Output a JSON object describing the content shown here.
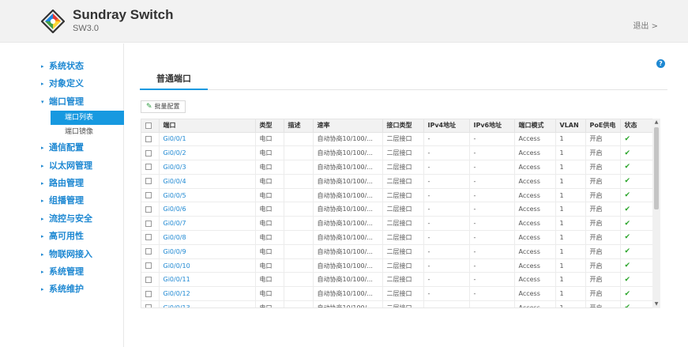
{
  "header": {
    "brand_title": "Sundray Switch",
    "brand_sub": "SW3.0",
    "logout": "退出 >"
  },
  "sidebar": {
    "items": [
      {
        "label": "系统状态",
        "arrow": "▸"
      },
      {
        "label": "对象定义",
        "arrow": "▸"
      },
      {
        "label": "端口管理",
        "arrow": "▾",
        "children": [
          {
            "label": "端口列表",
            "active": true
          },
          {
            "label": "端口镜像",
            "active": false
          }
        ]
      },
      {
        "label": "通信配置",
        "arrow": "▸"
      },
      {
        "label": "以太网管理",
        "arrow": "▸"
      },
      {
        "label": "路由管理",
        "arrow": "▸"
      },
      {
        "label": "组播管理",
        "arrow": "▸"
      },
      {
        "label": "流控与安全",
        "arrow": "▸"
      },
      {
        "label": "高可用性",
        "arrow": "▸"
      },
      {
        "label": "物联网接入",
        "arrow": "▸"
      },
      {
        "label": "系统管理",
        "arrow": "▸"
      },
      {
        "label": "系统维护",
        "arrow": "▸"
      }
    ]
  },
  "main": {
    "help": "?",
    "tab": "普通端口",
    "batch_button": "批量配置",
    "batch_icon": "✎",
    "table": {
      "columns": [
        "端口",
        "类型",
        "描述",
        "速率",
        "接口类型",
        "IPv4地址",
        "IPv6地址",
        "端口模式",
        "VLAN",
        "PoE供电",
        "状态"
      ],
      "rows": [
        {
          "port": "Gi0/0/1",
          "type": "电口",
          "desc": "",
          "rate": "自动协商10/100/...",
          "iface": "二层接口",
          "ipv4": "-",
          "ipv6": "-",
          "mode": "Access",
          "vlan": "1",
          "poe": "开启",
          "status": "✔"
        },
        {
          "port": "Gi0/0/2",
          "type": "电口",
          "desc": "",
          "rate": "自动协商10/100/...",
          "iface": "二层接口",
          "ipv4": "-",
          "ipv6": "-",
          "mode": "Access",
          "vlan": "1",
          "poe": "开启",
          "status": "✔"
        },
        {
          "port": "Gi0/0/3",
          "type": "电口",
          "desc": "",
          "rate": "自动协商10/100/...",
          "iface": "二层接口",
          "ipv4": "-",
          "ipv6": "-",
          "mode": "Access",
          "vlan": "1",
          "poe": "开启",
          "status": "✔"
        },
        {
          "port": "Gi0/0/4",
          "type": "电口",
          "desc": "",
          "rate": "自动协商10/100/...",
          "iface": "二层接口",
          "ipv4": "-",
          "ipv6": "-",
          "mode": "Access",
          "vlan": "1",
          "poe": "开启",
          "status": "✔"
        },
        {
          "port": "Gi0/0/5",
          "type": "电口",
          "desc": "",
          "rate": "自动协商10/100/...",
          "iface": "二层接口",
          "ipv4": "-",
          "ipv6": "-",
          "mode": "Access",
          "vlan": "1",
          "poe": "开启",
          "status": "✔"
        },
        {
          "port": "Gi0/0/6",
          "type": "电口",
          "desc": "",
          "rate": "自动协商10/100/...",
          "iface": "二层接口",
          "ipv4": "-",
          "ipv6": "-",
          "mode": "Access",
          "vlan": "1",
          "poe": "开启",
          "status": "✔"
        },
        {
          "port": "Gi0/0/7",
          "type": "电口",
          "desc": "",
          "rate": "自动协商10/100/...",
          "iface": "二层接口",
          "ipv4": "-",
          "ipv6": "-",
          "mode": "Access",
          "vlan": "1",
          "poe": "开启",
          "status": "✔"
        },
        {
          "port": "Gi0/0/8",
          "type": "电口",
          "desc": "",
          "rate": "自动协商10/100/...",
          "iface": "二层接口",
          "ipv4": "-",
          "ipv6": "-",
          "mode": "Access",
          "vlan": "1",
          "poe": "开启",
          "status": "✔"
        },
        {
          "port": "Gi0/0/9",
          "type": "电口",
          "desc": "",
          "rate": "自动协商10/100/...",
          "iface": "二层接口",
          "ipv4": "-",
          "ipv6": "-",
          "mode": "Access",
          "vlan": "1",
          "poe": "开启",
          "status": "✔"
        },
        {
          "port": "Gi0/0/10",
          "type": "电口",
          "desc": "",
          "rate": "自动协商10/100/...",
          "iface": "二层接口",
          "ipv4": "-",
          "ipv6": "-",
          "mode": "Access",
          "vlan": "1",
          "poe": "开启",
          "status": "✔"
        },
        {
          "port": "Gi0/0/11",
          "type": "电口",
          "desc": "",
          "rate": "自动协商10/100/...",
          "iface": "二层接口",
          "ipv4": "-",
          "ipv6": "-",
          "mode": "Access",
          "vlan": "1",
          "poe": "开启",
          "status": "✔"
        },
        {
          "port": "Gi0/0/12",
          "type": "电口",
          "desc": "",
          "rate": "自动协商10/100/...",
          "iface": "二层接口",
          "ipv4": "-",
          "ipv6": "-",
          "mode": "Access",
          "vlan": "1",
          "poe": "开启",
          "status": "✔"
        },
        {
          "port": "Gi0/0/13",
          "type": "电口",
          "desc": "",
          "rate": "自动协商10/100/...",
          "iface": "二层接口",
          "ipv4": "-",
          "ipv6": "-",
          "mode": "Access",
          "vlan": "1",
          "poe": "开启",
          "status": "✔"
        }
      ]
    }
  },
  "colors": {
    "accent": "#1799e0",
    "nav_text": "#1e88d2",
    "status_ok": "#2aa52a",
    "header_bg": "#f2f2f2"
  }
}
